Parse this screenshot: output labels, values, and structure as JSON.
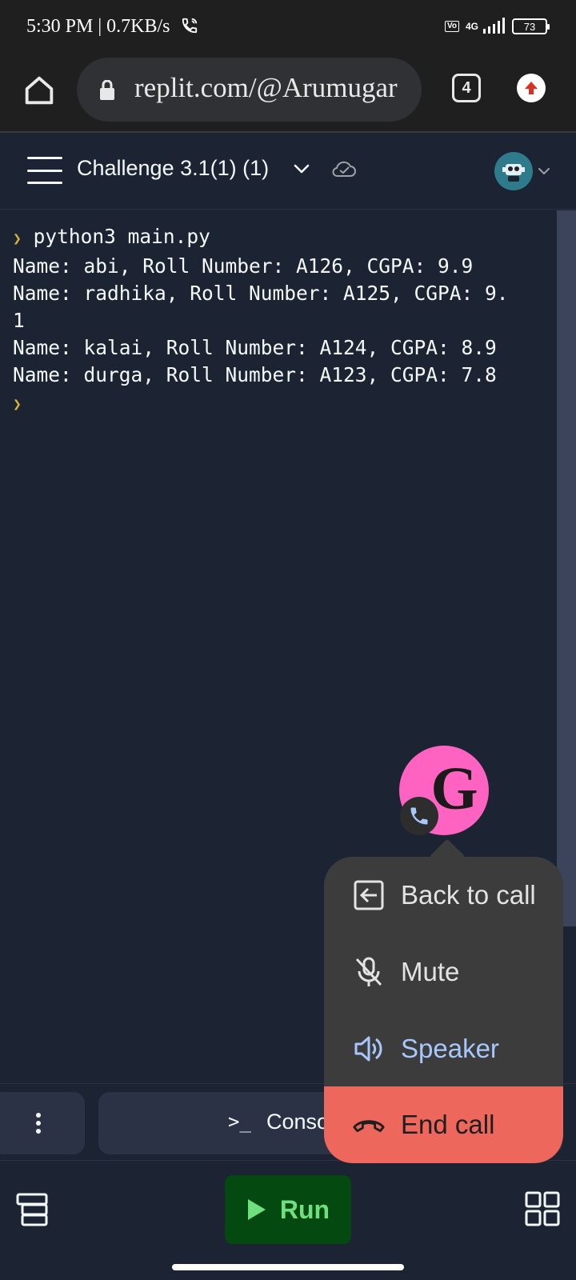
{
  "status": {
    "time": "5:30 PM | 0.7KB/s",
    "volte": "Vo\nLTE",
    "network": "4G",
    "battery": "73"
  },
  "browser": {
    "url": "replit.com/@Arumugar",
    "tab_count": "4"
  },
  "header": {
    "project_name": "Challenge 3.1(1) (1)"
  },
  "console": {
    "command": "python3 main.py",
    "lines": [
      "Name: abi, Roll Number: A126, CGPA: 9.9",
      "Name: radhika, Roll Number: A125, CGPA: 9.",
      "1",
      "Name: kalai, Roll Number: A124, CGPA: 8.9",
      "Name: durga, Roll Number: A123, CGPA: 7.8"
    ]
  },
  "call_bubble": {
    "avatar_letter": "G",
    "menu": {
      "back_to_call": "Back to call",
      "mute": "Mute",
      "speaker": "Speaker",
      "end_call": "End call"
    }
  },
  "tabs": {
    "more_icon": "more-vertical-icon",
    "console_label": "Conso",
    "console_icon": ">_"
  },
  "toolbar": {
    "run_label": "Run"
  },
  "colors": {
    "background": "#1c2333",
    "end_call": "#ee675c",
    "speaker_active": "#a8c7fa",
    "call_avatar": "#ff63c2",
    "run_bg": "#044a10",
    "run_text": "#6ee07f"
  }
}
